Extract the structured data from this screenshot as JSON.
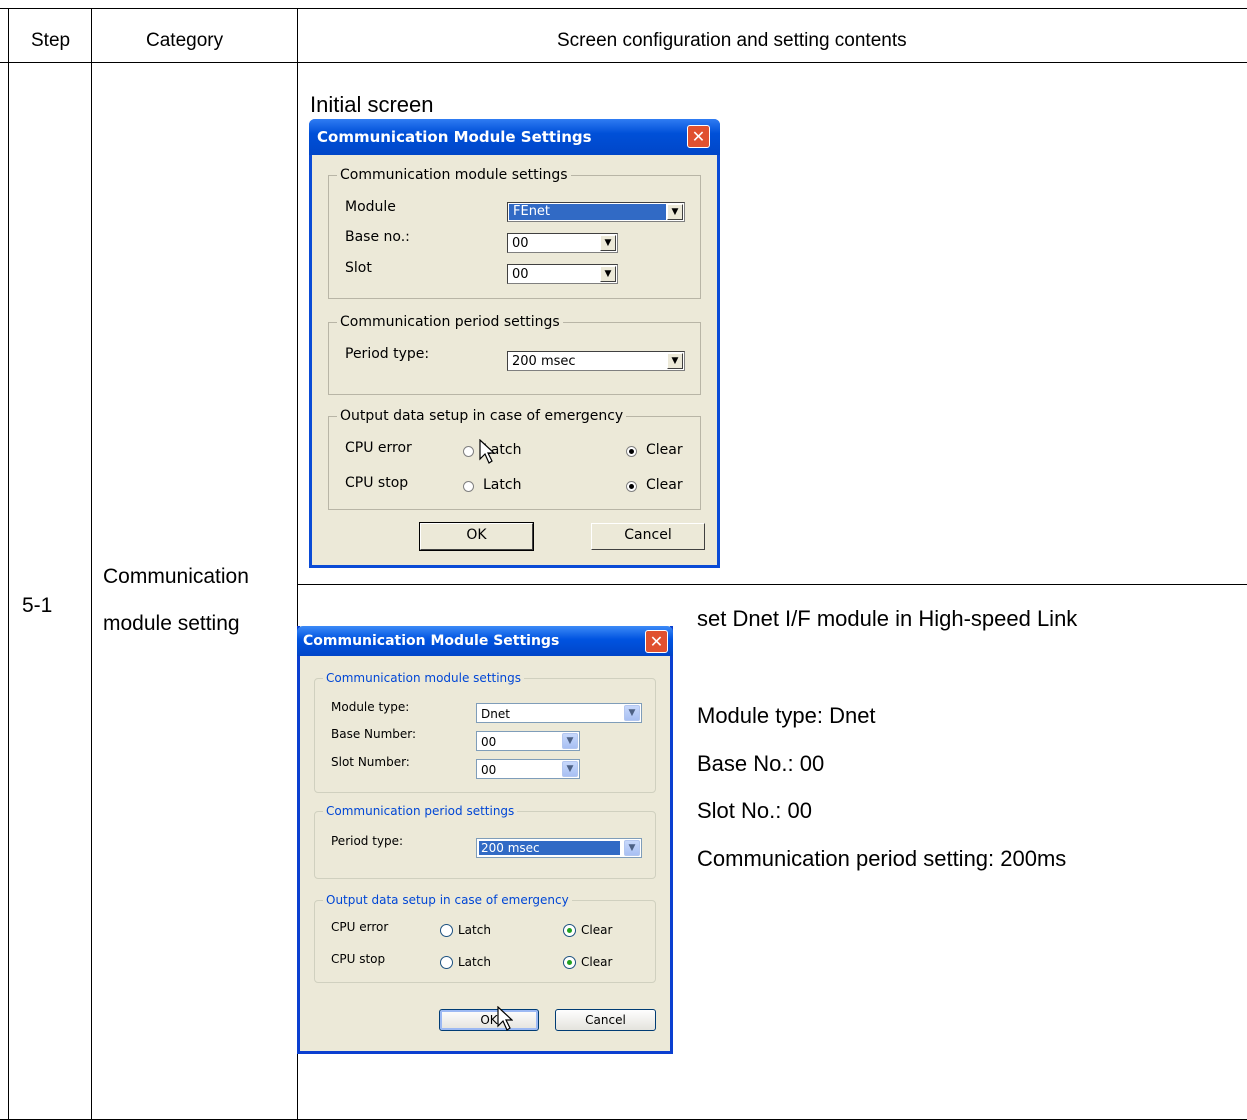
{
  "table": {
    "headers": {
      "step": "Step",
      "category": "Category",
      "contents": "Screen configuration and setting contents"
    },
    "step_value": "5-1",
    "category_line1": "Communication",
    "category_line2": "module setting"
  },
  "section1": {
    "caption": "Initial screen"
  },
  "dialog1": {
    "title": "Communication Module Settings",
    "close_glyph": "✕",
    "group_module": {
      "title": "Communication module settings",
      "module_label": "Module",
      "module_value": "FEnet",
      "base_label": "Base no.:",
      "base_value": "00",
      "slot_label": "Slot",
      "slot_value": "00"
    },
    "group_period": {
      "title": "Communication period settings",
      "period_label": "Period type:",
      "period_value": "200 msec"
    },
    "group_output": {
      "title": "Output data setup in case of emergency",
      "cpu_error_label": "CPU error",
      "cpu_stop_label": "CPU stop",
      "latch_label": "Latch",
      "clear_label": "Clear"
    },
    "ok_label": "OK",
    "cancel_label": "Cancel"
  },
  "dialog2": {
    "title": "Communication Module Settings",
    "close_glyph": "✕",
    "group_module": {
      "title": "Communication module settings",
      "module_label": "Module type:",
      "module_value": "Dnet",
      "base_label": "Base Number:",
      "base_value": "00",
      "slot_label": "Slot Number:",
      "slot_value": "00"
    },
    "group_period": {
      "title": "Communication period settings",
      "period_label": "Period type:",
      "period_value": "200 msec"
    },
    "group_output": {
      "title": "Output data setup in case of emergency",
      "cpu_error_label": "CPU error",
      "cpu_stop_label": "CPU stop",
      "latch_label": "Latch",
      "clear_label": "Clear"
    },
    "ok_label": "OK",
    "cancel_label": "Cancel"
  },
  "notes": {
    "line1": "set Dnet I/F module in High-speed Link",
    "line2": "Module type: Dnet",
    "line3": "Base No.: 00",
    "line4": "Slot No.: 00",
    "line5": "Communication period setting: 200ms"
  },
  "icons": {
    "dropdown_arrow": "▼",
    "cursor": "mouse-pointer-icon"
  }
}
